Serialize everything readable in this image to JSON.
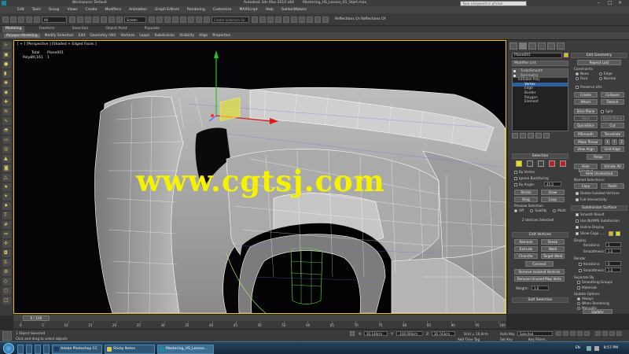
{
  "window": {
    "workspace_label": "Workspace: Default",
    "title": "Autodesk 3ds Max 2014 x64",
    "filename": "Mastering_HS_Lesson_01_Start.max",
    "search_placeholder": "Type a keyword or phrase"
  },
  "menu": [
    "Edit",
    "Tools",
    "Group",
    "Views",
    "Create",
    "Modifiers",
    "Animation",
    "Graph Editors",
    "Rendering",
    "Customize",
    "MAXScript",
    "Help",
    "GoldenMakers"
  ],
  "toolbar": {
    "selection_filter": "All",
    "view_dropdown": "Screen",
    "named_set_placeholder": "Create Selection Se",
    "tool_label": "Reflections Or Reflections Of"
  },
  "ribbon": {
    "tabs": [
      "Modeling",
      "Freeform",
      "Selection",
      "Object Paint",
      "Populate"
    ],
    "active_tab": "Modeling",
    "items": [
      "Polygon Modeling",
      "Modify Selection",
      "Edit",
      "Geometry (All)",
      "Vertices",
      "Loops",
      "Subdivision",
      "Visibility",
      "Align",
      "Properties"
    ]
  },
  "viewport": {
    "label": "[ + ] [Perspective ] [Shaded + Edged Faces ]",
    "stats_header": [
      "Total",
      "Plane001"
    ],
    "stats_row_label": "Polys:",
    "stats_values": [
      "20,161",
      "1"
    ],
    "watermark": "www.cgtsj.com"
  },
  "command_panel": {
    "object_name": "Plane001",
    "modifier_list": "Modifier List",
    "stack": [
      {
        "label": "TurboSmooth",
        "type": "hdr"
      },
      {
        "label": "Symmetry",
        "type": "hdr"
      },
      {
        "label": "Editable Poly",
        "type": "normal"
      },
      {
        "label": "Vertex",
        "type": "sel"
      },
      {
        "label": "Edge",
        "type": "normal"
      },
      {
        "label": "Border",
        "type": "normal"
      },
      {
        "label": "Polygon",
        "type": "normal"
      },
      {
        "label": "Element",
        "type": "normal"
      }
    ],
    "selection": {
      "title": "Selection",
      "by_vertex": "By Vertex",
      "ignore_backfacing": "Ignore Backfacing",
      "by_angle": "By Angle:",
      "by_angle_value": "45.0",
      "shrink": "Shrink",
      "grow": "Grow",
      "ring": "Ring",
      "loop": "Loop",
      "preview_selection": "Preview Selection",
      "preview_off": "Off",
      "preview_subobj": "SubObj",
      "preview_multi": "Multi",
      "status": "2 Vertices Selected"
    },
    "edit_vertices": {
      "title": "Edit Vertices",
      "remove": "Remove",
      "break": "Break",
      "extrude": "Extrude",
      "weld": "Weld",
      "chamfer": "Chamfer",
      "target_weld": "Target Weld",
      "connect": "Connect",
      "remove_isolated": "Remove Isolated Vertices",
      "remove_unused": "Remove Unused Map Verts",
      "weight_label": "Weight:",
      "weight_value": "1.0"
    },
    "soft_selection": "Soft Selection",
    "edit_geometry": {
      "title": "Edit Geometry",
      "repeat_last": "Repeat Last",
      "constraints": "Constraints",
      "none": "None",
      "edge": "Edge",
      "face": "Face",
      "normal": "Normal",
      "preserve_uvs": "Preserve UVs",
      "create": "Create",
      "collapse": "Collapse",
      "attach": "Attach",
      "detach": "Detach",
      "slice_plane": "Slice Plane",
      "split": "Split",
      "slice": "Slice",
      "reset_plane": "Reset Plane",
      "quickslice": "QuickSlice",
      "cut": "Cut",
      "msmooth": "MSmooth",
      "tessellate": "Tessellate",
      "make_planar": "Make Planar",
      "x": "X",
      "y": "Y",
      "z": "Z",
      "view_align": "View Align",
      "grid_align": "Grid Align",
      "relax": "Relax",
      "hide_selected": "Hide Selected",
      "unhide_all": "Unhide All",
      "hide_unselected": "Hide Unselected",
      "named_selections": "Named Selections:",
      "copy": "Copy",
      "paste": "Paste",
      "delete_isolated": "Delete Isolated Vertices",
      "full_interactivity": "Full Interactivity"
    },
    "subdivision_surface": {
      "title": "Subdivision Surface",
      "smooth_result": "Smooth Result",
      "use_nurms": "Use NURMS Subdivision",
      "isoline_display": "Isoline Display",
      "show_cage": "Show Cage......",
      "display": "Display",
      "iterations": "Iterations:",
      "iterations_value": "1",
      "smoothness": "Smoothness:",
      "smoothness_value": "1.0",
      "render": "Render",
      "r_iterations_value": "0",
      "r_smoothness_value": "1.0",
      "separate_by": "Separate By",
      "smoothing_groups": "Smoothing Groups",
      "materials": "Materials",
      "update_options": "Update Options",
      "always": "Always",
      "when_rendering": "When Rendering",
      "manually": "Manually",
      "update": "Update"
    }
  },
  "timeline": {
    "frame_counter": "0 / 100",
    "ticks": [
      "0",
      "5",
      "10",
      "15",
      "20",
      "25",
      "30",
      "35",
      "40",
      "45",
      "50",
      "55",
      "60",
      "65",
      "70",
      "75",
      "80",
      "85",
      "90",
      "95",
      "100"
    ]
  },
  "status": {
    "selected": "1 Object Selected",
    "hint": "Click and drag to select objects",
    "x_label": "X:",
    "x_value": "20.144cm",
    "y_label": "Y:",
    "y_value": "-100.000cm",
    "z_label": "Z:",
    "z_value": "30.743cm",
    "grid": "Grid = 10.0cm",
    "auto_key": "Auto Key",
    "auto_key_value": "Selected",
    "set_key": "Set Key",
    "key_filters": "Key Filters...",
    "add_time_tag": "Add Time Tag"
  },
  "taskbar": {
    "apps": [
      "Adobe Photoshop CC",
      "Sticky Notes",
      "Mastering_HS_Lesson..."
    ],
    "lang": "EN",
    "time": "8:57 PM"
  },
  "colors": {
    "viewport_border": "#f5c400",
    "watermark": "#f4f200",
    "selection_blue": "#2e5fa0",
    "gizmo_y": "#27c227",
    "gizmo_x": "#e01818",
    "gizmo_center": "#e3df3a"
  }
}
